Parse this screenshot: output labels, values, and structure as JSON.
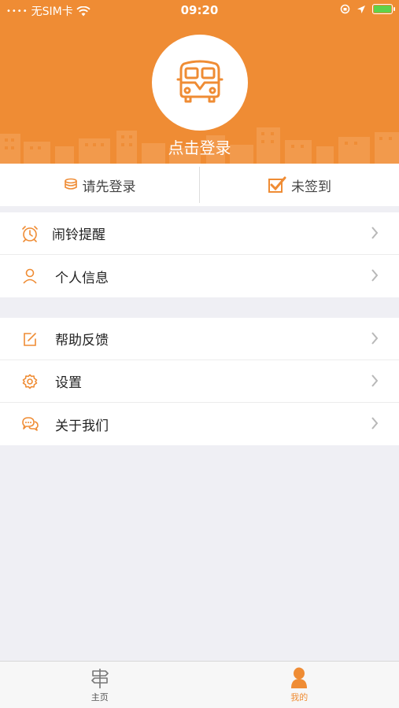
{
  "status_bar": {
    "carrier": "无SIM卡",
    "time": "09:20"
  },
  "header": {
    "login_prompt": "点击登录"
  },
  "actions": {
    "login_label": "请先登录",
    "signin_label": "未签到"
  },
  "menu_group_1": [
    {
      "label": "闹铃提醒",
      "icon": "alarm-clock-icon"
    },
    {
      "label": "个人信息",
      "icon": "person-icon"
    }
  ],
  "menu_group_2": [
    {
      "label": "帮助反馈",
      "icon": "edit-icon"
    },
    {
      "label": "设置",
      "icon": "gear-icon"
    },
    {
      "label": "关于我们",
      "icon": "chat-icon"
    }
  ],
  "tabs": {
    "home_label": "主页",
    "mine_label": "我的"
  },
  "colors": {
    "accent": "#ef8c34",
    "background": "#efeff4"
  }
}
